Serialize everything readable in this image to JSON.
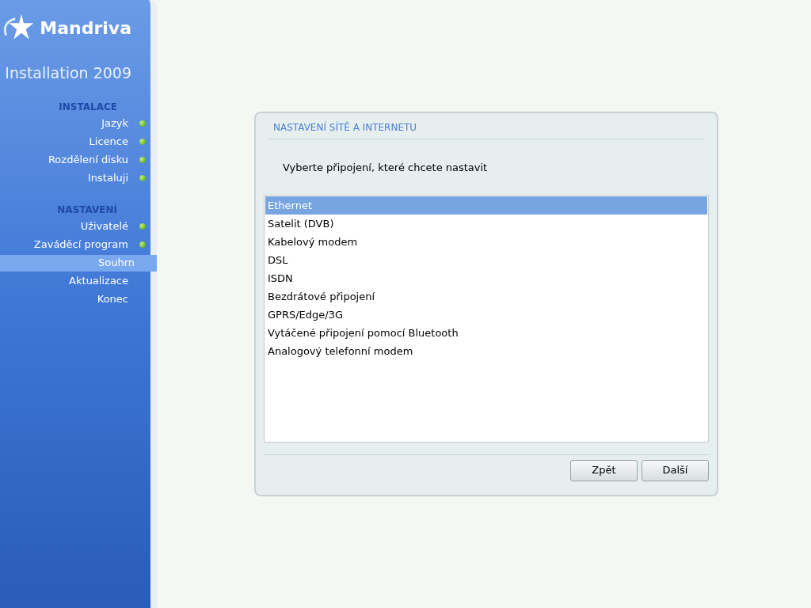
{
  "brand": {
    "logo": "Mandriva",
    "subtitle": "Installation 2009"
  },
  "sidebar": {
    "sections": [
      {
        "title": "INSTALACE",
        "items": [
          {
            "label": "Jazyk",
            "done": true,
            "selected": false
          },
          {
            "label": "Licence",
            "done": true,
            "selected": false
          },
          {
            "label": "Rozdělení disku",
            "done": true,
            "selected": false
          },
          {
            "label": "Instaluji",
            "done": true,
            "selected": false
          }
        ]
      },
      {
        "title": "NASTAVENÍ",
        "items": [
          {
            "label": "Uživatelé",
            "done": true,
            "selected": false
          },
          {
            "label": "Zaváděcí program",
            "done": true,
            "selected": false
          },
          {
            "label": "Souhrn",
            "done": false,
            "selected": true
          },
          {
            "label": "Aktualizace",
            "done": false,
            "selected": false
          },
          {
            "label": "Konec",
            "done": false,
            "selected": false
          }
        ]
      }
    ]
  },
  "dialog": {
    "title": "NASTAVENÍ SÍTĚ A INTERNETU",
    "prompt": "Vyberte připojení, které chcete nastavit",
    "options": [
      {
        "label": "Ethernet",
        "selected": true
      },
      {
        "label": "Satelit (DVB)",
        "selected": false
      },
      {
        "label": "Kabelový modem",
        "selected": false
      },
      {
        "label": "DSL",
        "selected": false
      },
      {
        "label": "ISDN",
        "selected": false
      },
      {
        "label": "Bezdrátové připojení",
        "selected": false
      },
      {
        "label": "GPRS/Edge/3G",
        "selected": false
      },
      {
        "label": "Vytáčené připojení pomocí Bluetooth",
        "selected": false
      },
      {
        "label": "Analogový telefonní modem",
        "selected": false
      }
    ],
    "buttons": [
      "Zpět",
      "Další"
    ]
  }
}
